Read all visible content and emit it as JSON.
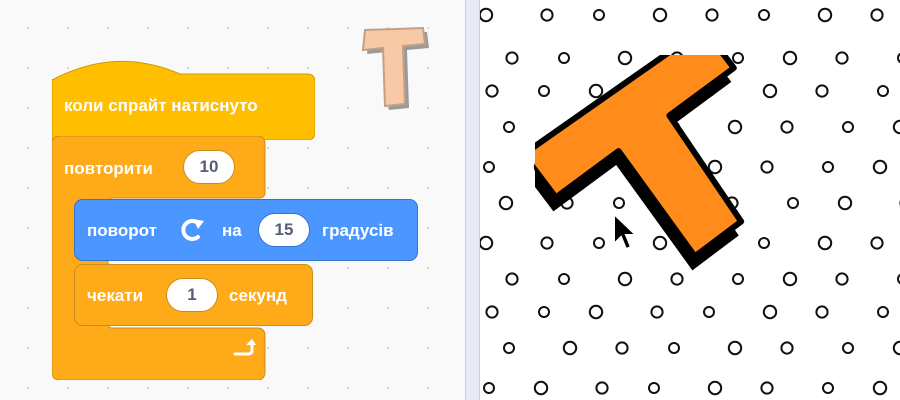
{
  "blocks": {
    "hat": {
      "label": "коли спрайт натиснуто"
    },
    "repeat": {
      "label": "повторити",
      "count": "10",
      "loop_arrow_icon": "loop-arrow-icon"
    },
    "turn": {
      "label_start": "поворот",
      "direction_icon": "rotate-clockwise-icon",
      "label_mid": "на",
      "degrees": "15",
      "label_end": "градусів"
    },
    "wait": {
      "label_start": "чекати",
      "seconds": "1",
      "label_end": "секунд"
    }
  },
  "sprite_thumbnail": {
    "letter": "T"
  },
  "stage": {
    "sprite_letter": "T",
    "backdrop": "polka-dot-circles"
  },
  "colors": {
    "events": "#ffbf00",
    "control": "#ffab19",
    "motion": "#4c97ff",
    "sprite_fill": "#ff8c1a"
  }
}
